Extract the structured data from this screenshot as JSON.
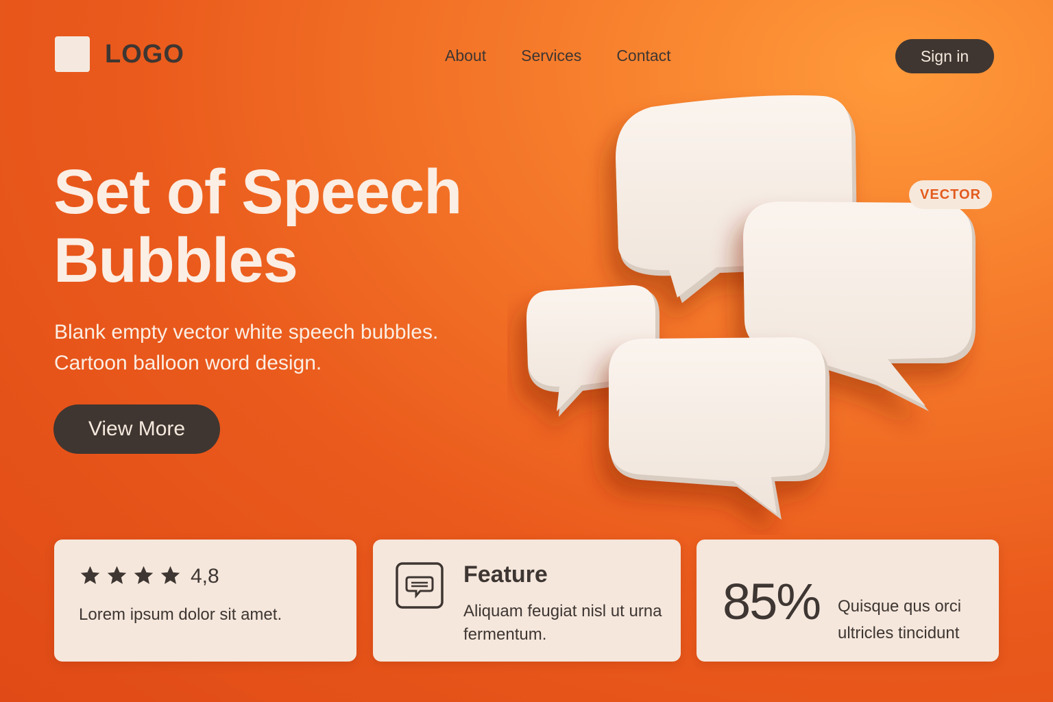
{
  "header": {
    "logo_text": "LOGO",
    "nav": [
      {
        "label": "About"
      },
      {
        "label": "Services"
      },
      {
        "label": "Contact"
      }
    ],
    "signin_label": "Sign in"
  },
  "hero": {
    "title_line1": "Set of Speech",
    "title_line2": "Bubbles",
    "subtitle_line1": "Blank empty vector white speech bubbles.",
    "subtitle_line2": "Cartoon balloon word design.",
    "cta_label": "View More",
    "badge": "VECTOR"
  },
  "cards": {
    "rating": {
      "stars": 4,
      "value": "4,8",
      "text": "Lorem ipsum dolor sit amet."
    },
    "feature": {
      "icon": "chat-icon",
      "title": "Feature",
      "text": "Aliquam feugiat nisl ut urna fermentum."
    },
    "stat": {
      "value": "85%",
      "text": "Quisque qus orci ultricles tincidunt"
    }
  },
  "colors": {
    "accent": "#ea5a1c",
    "dark": "#3f3631",
    "light": "#f5e7dc"
  }
}
